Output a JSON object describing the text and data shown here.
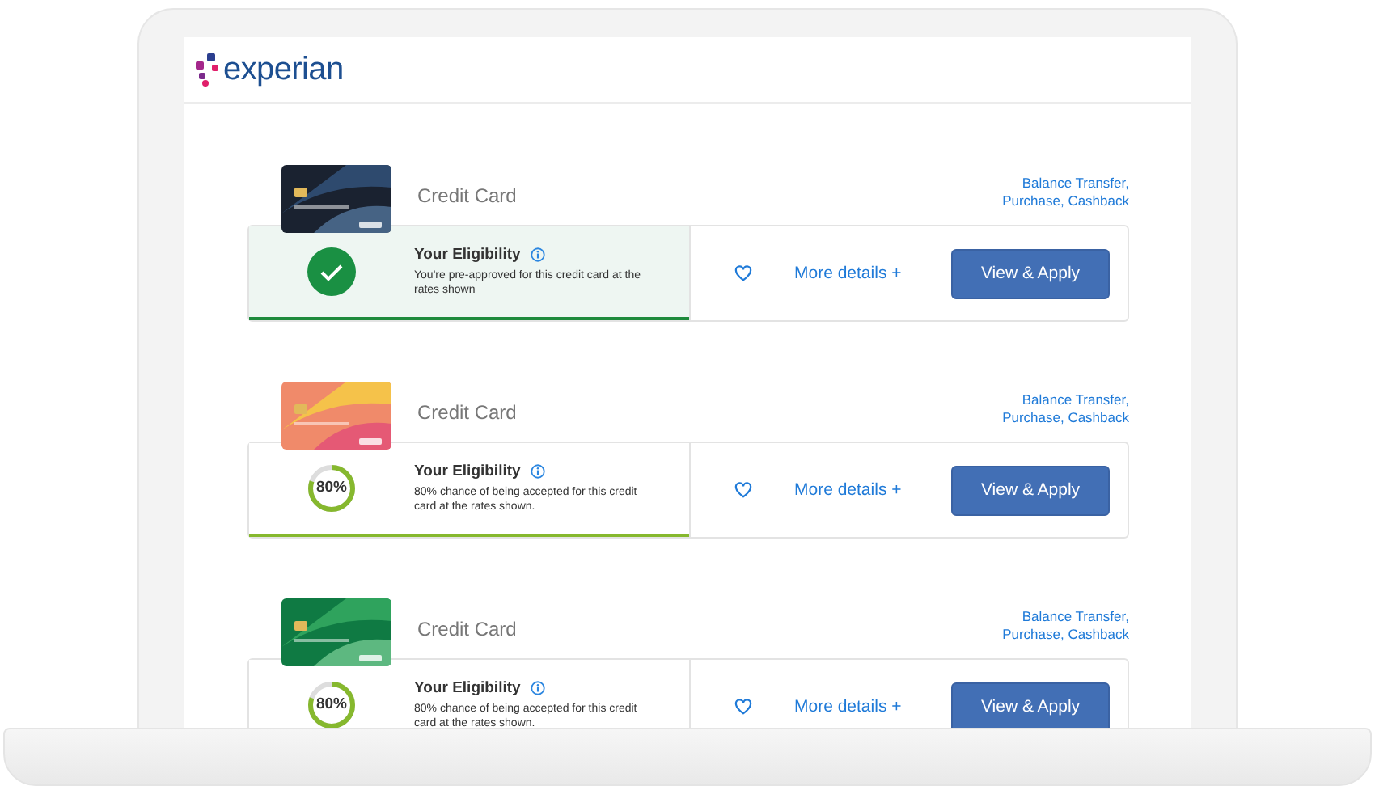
{
  "logo": {
    "text": "experian"
  },
  "offers": [
    {
      "title": "Credit Card",
      "tags": "Balance Transfer, Purchase, Cashback",
      "eligibility": {
        "kind": "approved",
        "heading": "Your Eligibility",
        "text": "You're pre-approved for this credit card at the rates shown"
      },
      "favourite": false,
      "details": "More details +",
      "apply": "View & Apply"
    },
    {
      "title": "Credit Card",
      "tags": "Balance Transfer, Purchase, Cashback",
      "eligibility": {
        "kind": "chance",
        "level": 0.8,
        "reading": "80%",
        "heading": "Your Eligibility",
        "text": "80% chance of being accepted for this credit card at the rates shown."
      },
      "favourite": false,
      "details": "More details +",
      "apply": "View & Apply"
    },
    {
      "title": "Credit Card",
      "tags": "Balance Transfer, Purchase, Cashback",
      "eligibility": {
        "kind": "chance",
        "level": 0.8,
        "reading": "80%",
        "heading": "Your Eligibility",
        "text": "80% chance of being accepted for this credit card at the rates shown."
      },
      "favourite": false,
      "details": "More details +",
      "apply": "View & Apply"
    }
  ]
}
